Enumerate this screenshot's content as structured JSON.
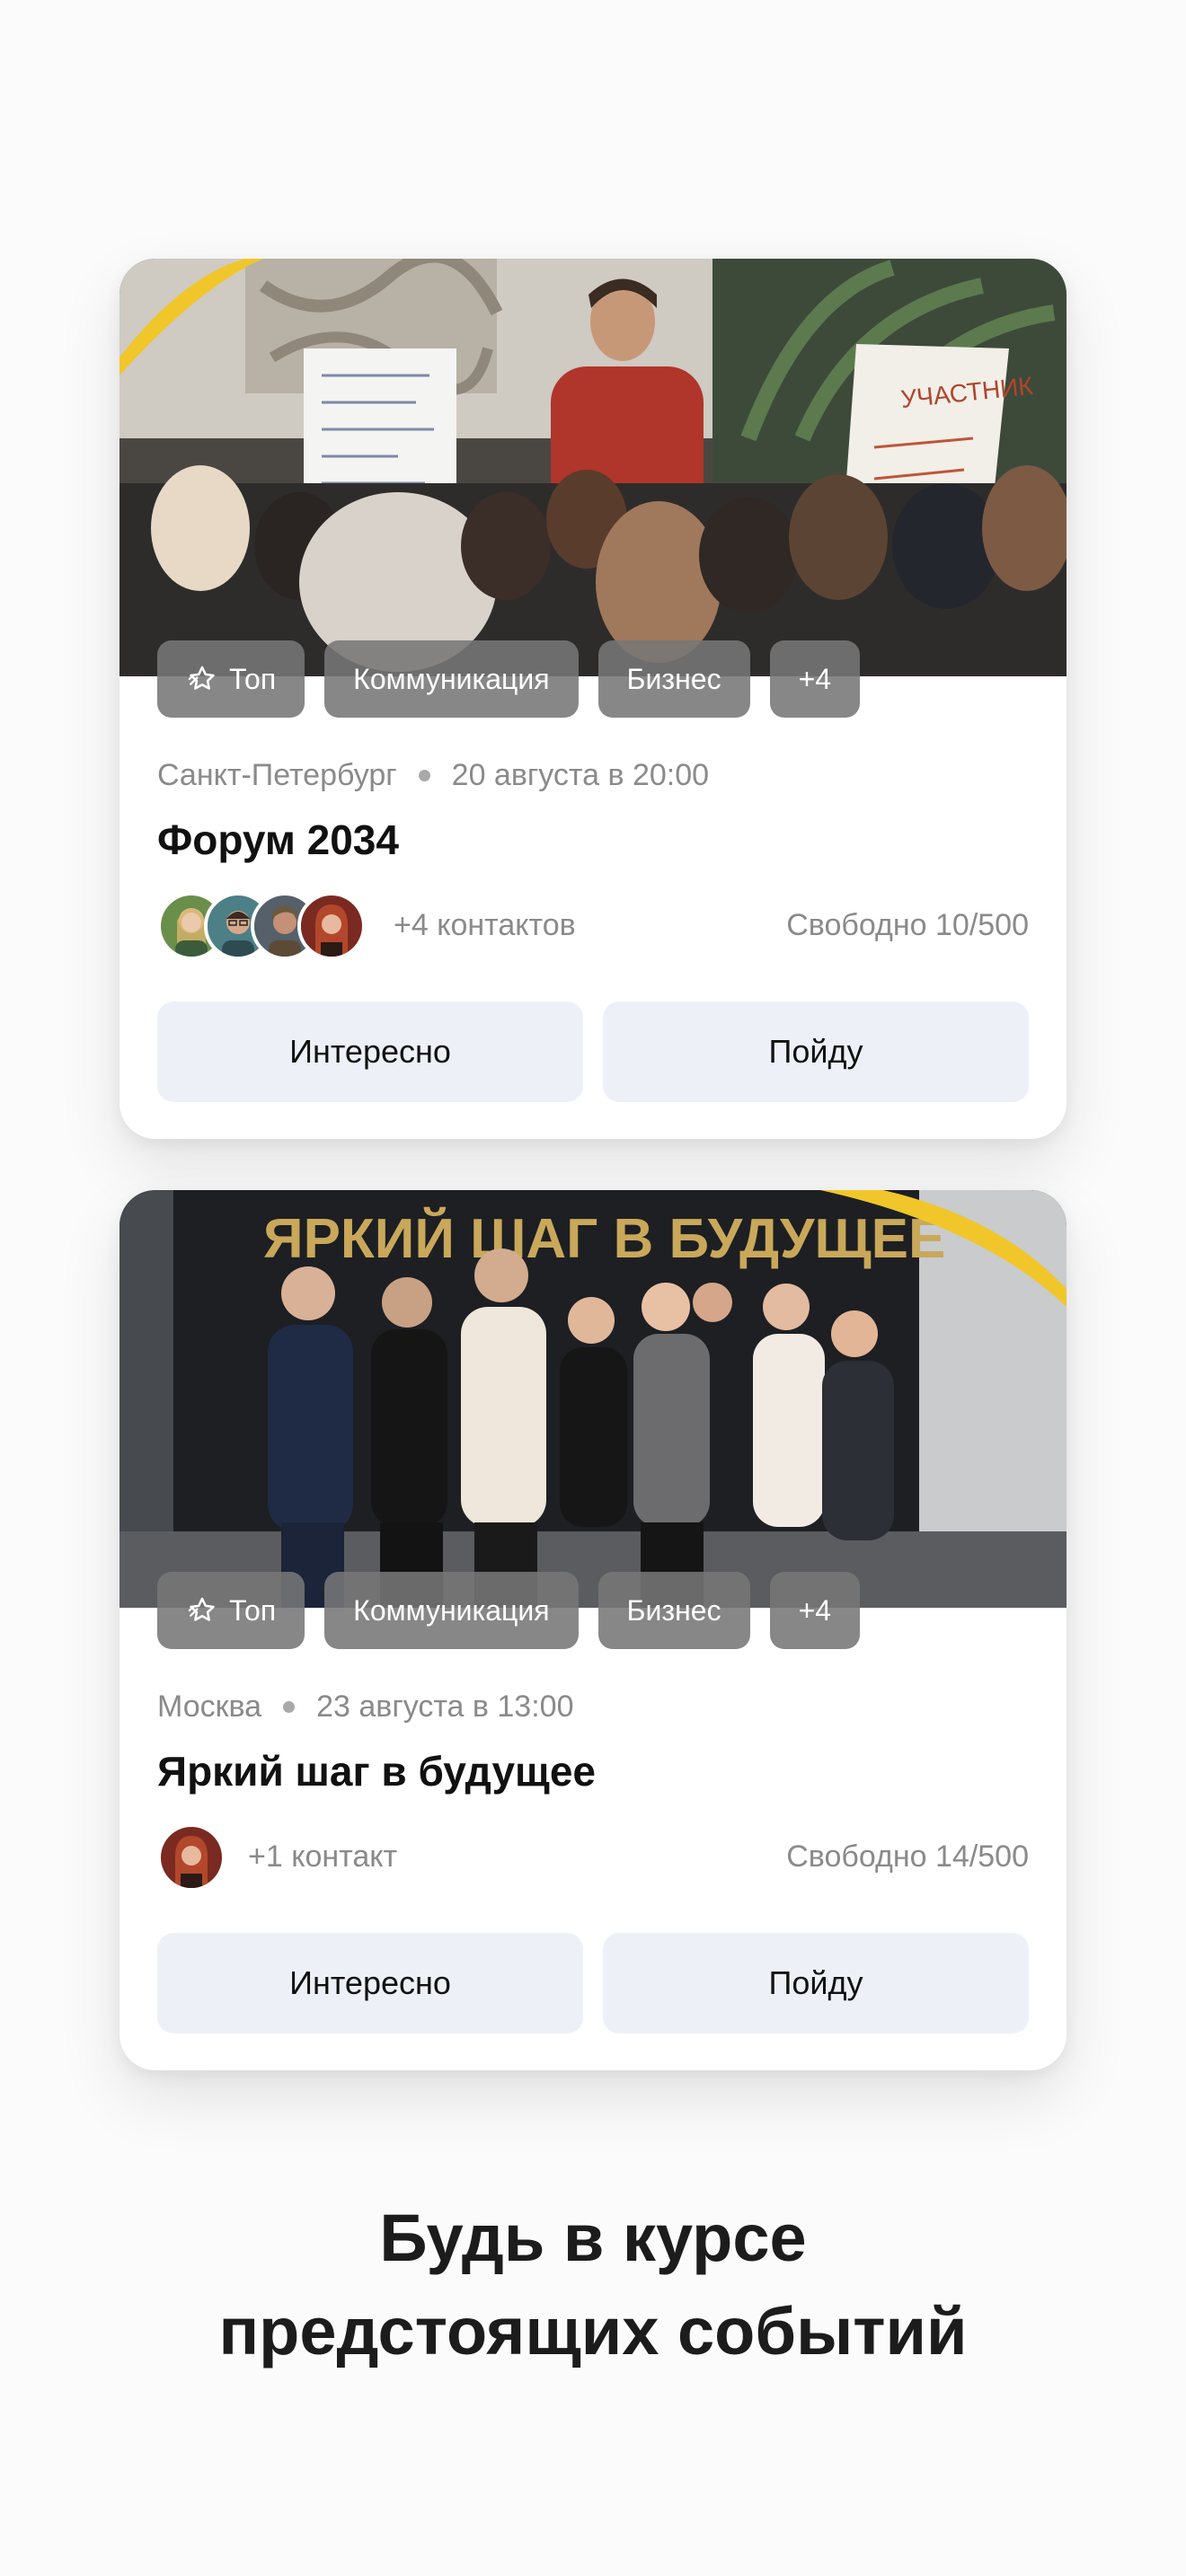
{
  "colors": {
    "accent_arc": "#f0c62a",
    "button_bg": "#edf1f7",
    "tag_bg": "#767676"
  },
  "events": [
    {
      "tags": {
        "top": "Топ",
        "t1": "Коммуникация",
        "t2": "Бизнес",
        "more": "+4"
      },
      "city": "Санкт-Петербург",
      "datetime": "20 августа в 20:00",
      "title": "Форум 2034",
      "contacts": "+4 контактов",
      "free": "Свободно 10/500",
      "interested": "Интересно",
      "going": "Пойду",
      "photo_signs": {
        "flipchart": "УЧАСТНИК"
      }
    },
    {
      "tags": {
        "top": "Топ",
        "t1": "Коммуникация",
        "t2": "Бизнес",
        "more": "+4"
      },
      "city": "Москва",
      "datetime": "23 августа в 13:00",
      "title": "Яркий шаг в будущее",
      "contacts": "+1 контакт",
      "free": "Свободно 14/500",
      "interested": "Интересно",
      "going": "Пойду",
      "photo_signs": {
        "banner": "ЯРКИЙ ШАГ  В БУДУЩЕЕ"
      }
    }
  ],
  "headline": {
    "line1": "Будь в курсе",
    "line2": "предстоящих событий"
  }
}
